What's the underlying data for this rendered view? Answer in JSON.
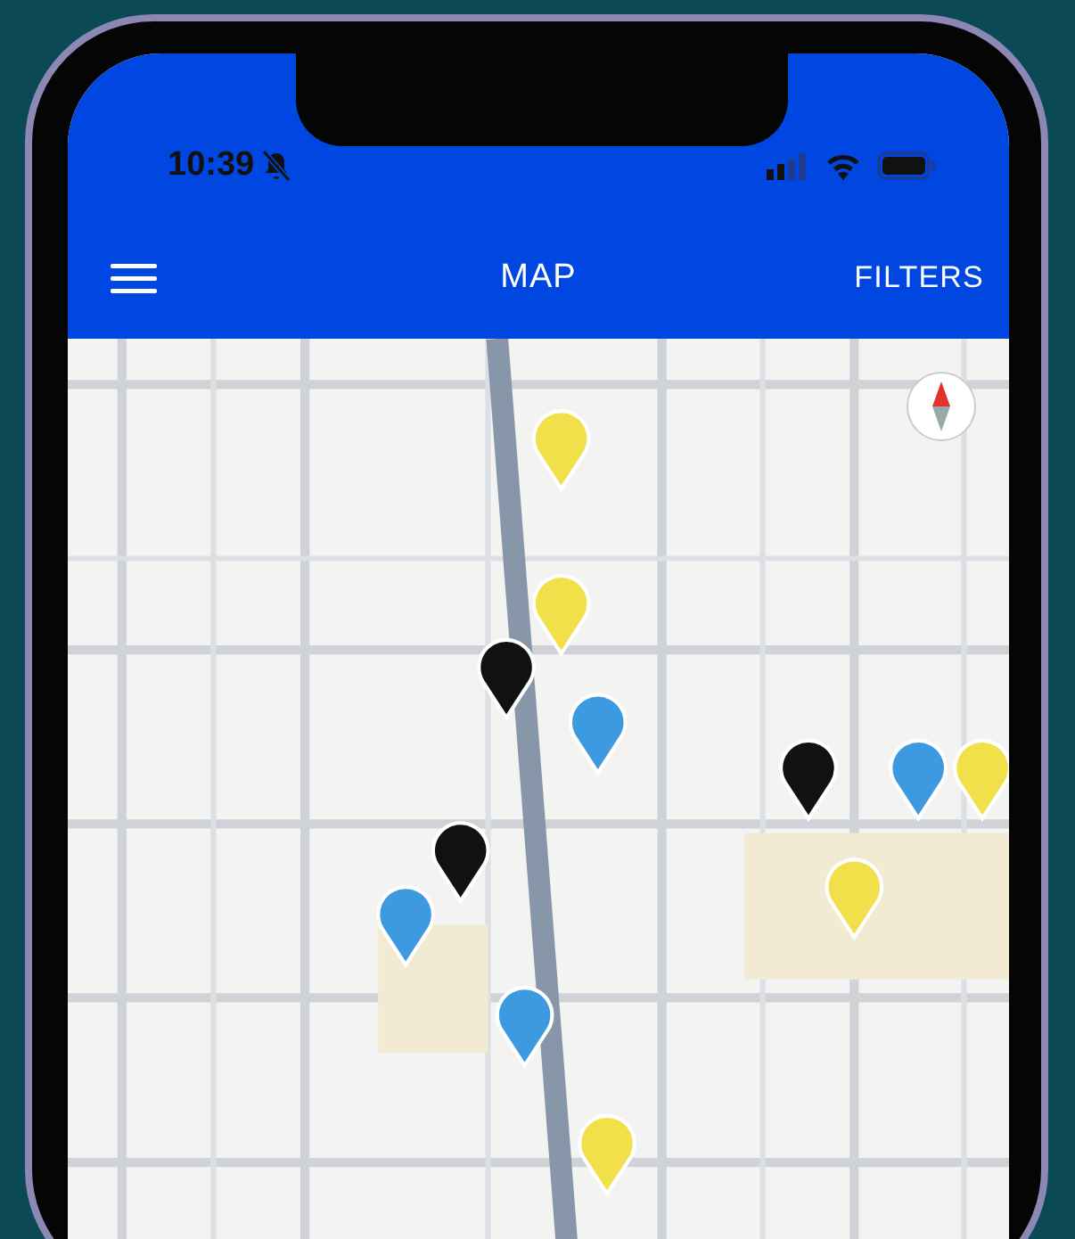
{
  "status_bar": {
    "time": "10:39"
  },
  "header": {
    "title": "MAP",
    "action": "FILTERS"
  }
}
